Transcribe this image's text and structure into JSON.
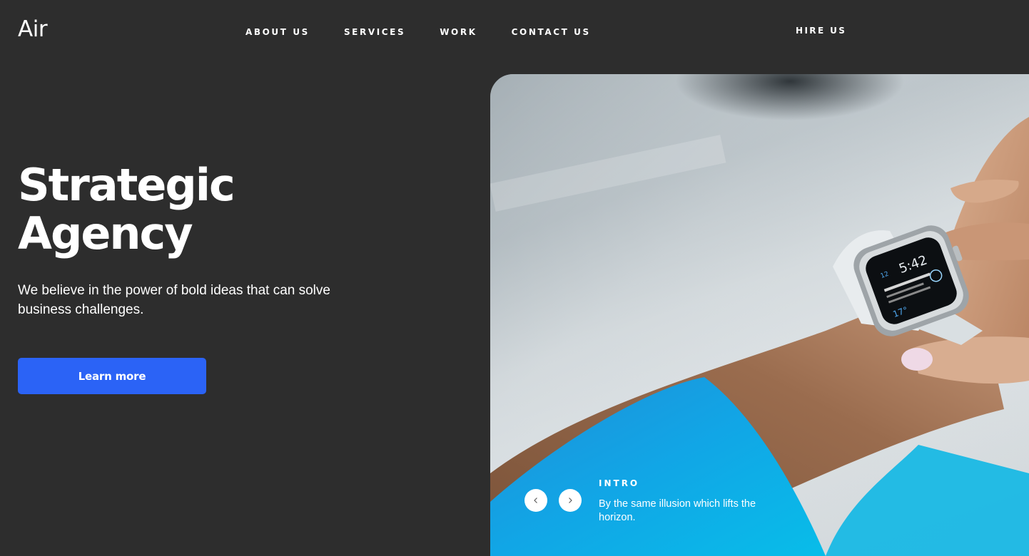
{
  "brand": {
    "logo_text": "Air"
  },
  "nav": {
    "items": [
      {
        "label": "ABOUT US"
      },
      {
        "label": "SERVICES"
      },
      {
        "label": "WORK"
      },
      {
        "label": "CONTACT US"
      }
    ],
    "cta_label": "HIRE US"
  },
  "hero": {
    "title_line1": "Strategic",
    "title_line2": "Agency",
    "subtitle": "We believe in the power of bold ideas that can solve business challenges.",
    "button_label": "Learn more",
    "button_color": "#2b63f6",
    "image_alt_icon": "smartwatch-photo"
  },
  "slider": {
    "label": "INTRO",
    "caption": "By the same illusion which lifts the horizon.",
    "prev_icon": "chevron-left-icon",
    "next_icon": "chevron-right-icon"
  },
  "colors": {
    "background": "#2d2d2d",
    "text": "#ffffff",
    "accent": "#2b63f6"
  }
}
